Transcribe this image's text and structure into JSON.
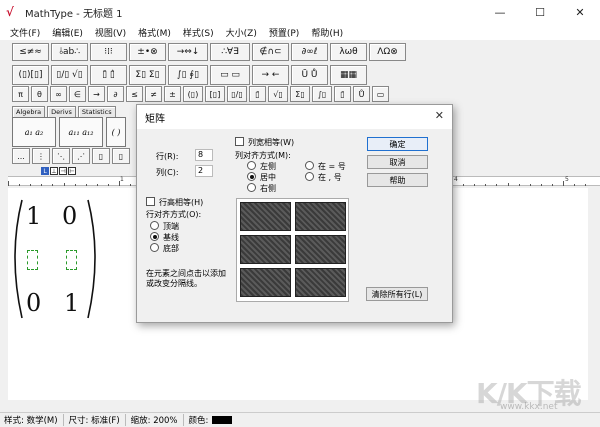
{
  "window": {
    "app_icon": "mathtype-logo-icon",
    "title": "MathType - 无标题 1",
    "minimize": "—",
    "maximize": "☐",
    "close": "✕"
  },
  "menu": [
    "文件(F)",
    "编辑(E)",
    "视图(V)",
    "格式(M)",
    "样式(S)",
    "大小(Z)",
    "预置(P)",
    "帮助(H)"
  ],
  "toolbar": {
    "row1": [
      "≤≠≈",
      "⫰ab∴",
      "⁝⁞⁝",
      "±•⊗",
      "→⇔↓",
      "∴∀∃",
      "∉∩⊂",
      "∂∞ℓ",
      "λωθ",
      "ΛΩ⊗"
    ],
    "row2": [
      "(▯)[▯]",
      "▯/▯ √▯",
      "▯̄ ▯̂",
      "Σ▯ Σ▯",
      "∫▯ ∮▯",
      "▭ ▭",
      "→ ←",
      "Ū Ů",
      "▦▦"
    ],
    "row3": [
      "π",
      "θ",
      "∞",
      "∈",
      "→",
      "∂",
      "≤",
      "≠",
      "±",
      "(▯)",
      "[▯]",
      "▯/▯",
      "▯̄",
      "√▯",
      "Σ▯",
      "∫▯",
      "▯̄",
      "Ů",
      "▭"
    ],
    "tabs": [
      "Algebra",
      "Derivs",
      "Statistics"
    ],
    "row5": [
      "...",
      "⋮",
      "⋱",
      "⋰",
      "▯",
      "▯"
    ]
  },
  "ruler": {
    "labels": [
      "1",
      "2",
      "3",
      "4",
      "5"
    ],
    "tab_buttons": [
      "L",
      "⊥",
      "⊣",
      "⊢"
    ]
  },
  "document": {
    "matrix": {
      "r1c1": "1",
      "r1c2": "0",
      "r3c1": "0",
      "r3c2": "1"
    }
  },
  "statusbar": {
    "style": "样式: 数学(M)",
    "size": "尺寸: 标准(F)",
    "zoom": "缩放: 200%",
    "color": "颜色:"
  },
  "dialog": {
    "title": "矩阵",
    "close": "✕",
    "rows_label": "行(R):",
    "rows_value": "8",
    "cols_label": "列(C):",
    "cols_value": "2",
    "equal_cols_label": "列宽相等(W)",
    "col_align_label": "列对齐方式(M):",
    "col_align_options": [
      "左侧",
      "居中",
      "右侧"
    ],
    "col_align_extra": [
      "在 = 号",
      "在 , 号"
    ],
    "col_align_selected": "居中",
    "equal_rows_label": "行高相等(H)",
    "row_align_label": "行对齐方式(O):",
    "row_align_options": [
      "顶端",
      "基线",
      "底部"
    ],
    "row_align_selected": "基线",
    "hint": "在元素之间点击以添加或改变分隔线。",
    "ok": "确定",
    "cancel": "取消",
    "help": "帮助",
    "clear_lines": "清除所有行(L)"
  },
  "watermark": {
    "logo": "KK下载",
    "url": "www.kkx.net"
  }
}
